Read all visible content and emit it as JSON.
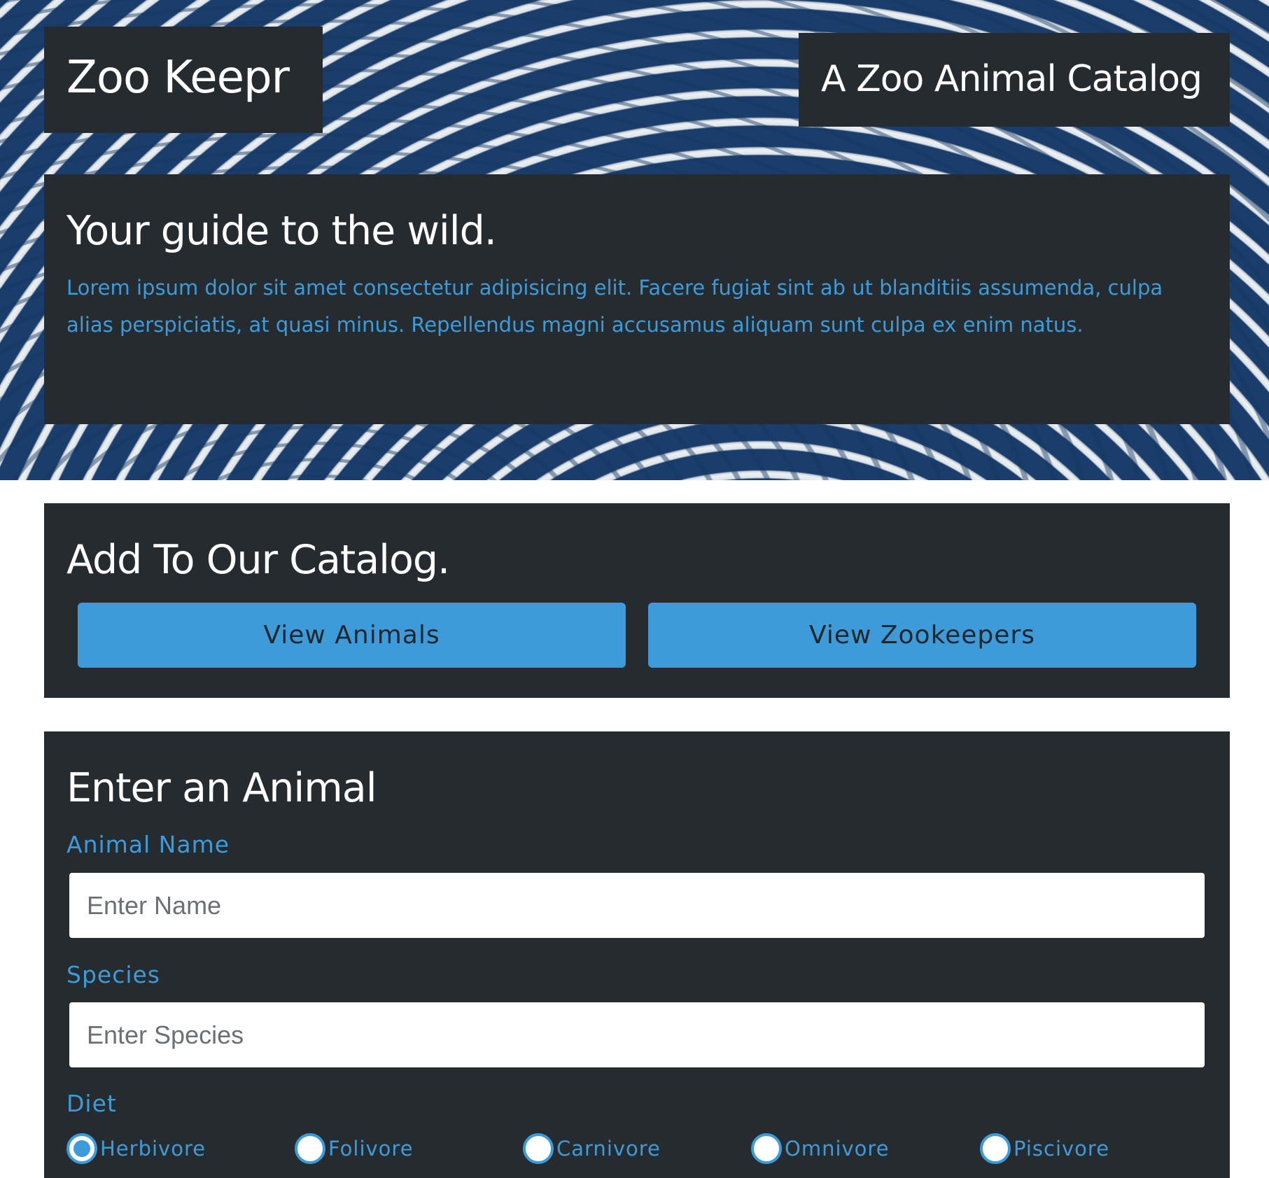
{
  "header": {
    "brand": "Zoo Keepr",
    "tagline": "A Zoo Animal Catalog"
  },
  "intro": {
    "heading": "Your guide to the wild.",
    "text": "Lorem ipsum dolor sit amet consectetur adipisicing elit. Facere fugiat sint ab ut blanditiis assumenda, culpa alias perspiciatis, at quasi minus. Repellendus magni accusamus aliquam sunt culpa ex enim natus."
  },
  "catalog": {
    "heading": "Add To Our Catalog.",
    "view_animals_label": "View Animals",
    "view_zookeepers_label": "View Zookeepers"
  },
  "animal_form": {
    "heading": "Enter an Animal",
    "name_label": "Animal Name",
    "name_placeholder": "Enter Name",
    "name_value": "",
    "species_label": "Species",
    "species_placeholder": "Enter Species",
    "species_value": "",
    "diet_label": "Diet",
    "diet_options": [
      {
        "label": "Herbivore",
        "checked": true
      },
      {
        "label": "Folivore",
        "checked": false
      },
      {
        "label": "Carnivore",
        "checked": false
      },
      {
        "label": "Omnivore",
        "checked": false
      },
      {
        "label": "Piscivore",
        "checked": false
      }
    ]
  },
  "colors": {
    "panel": "#262b2f",
    "accent": "#3d9bd9",
    "hero_blue": "#1d4270",
    "stripe_white": "#e8ecef"
  }
}
